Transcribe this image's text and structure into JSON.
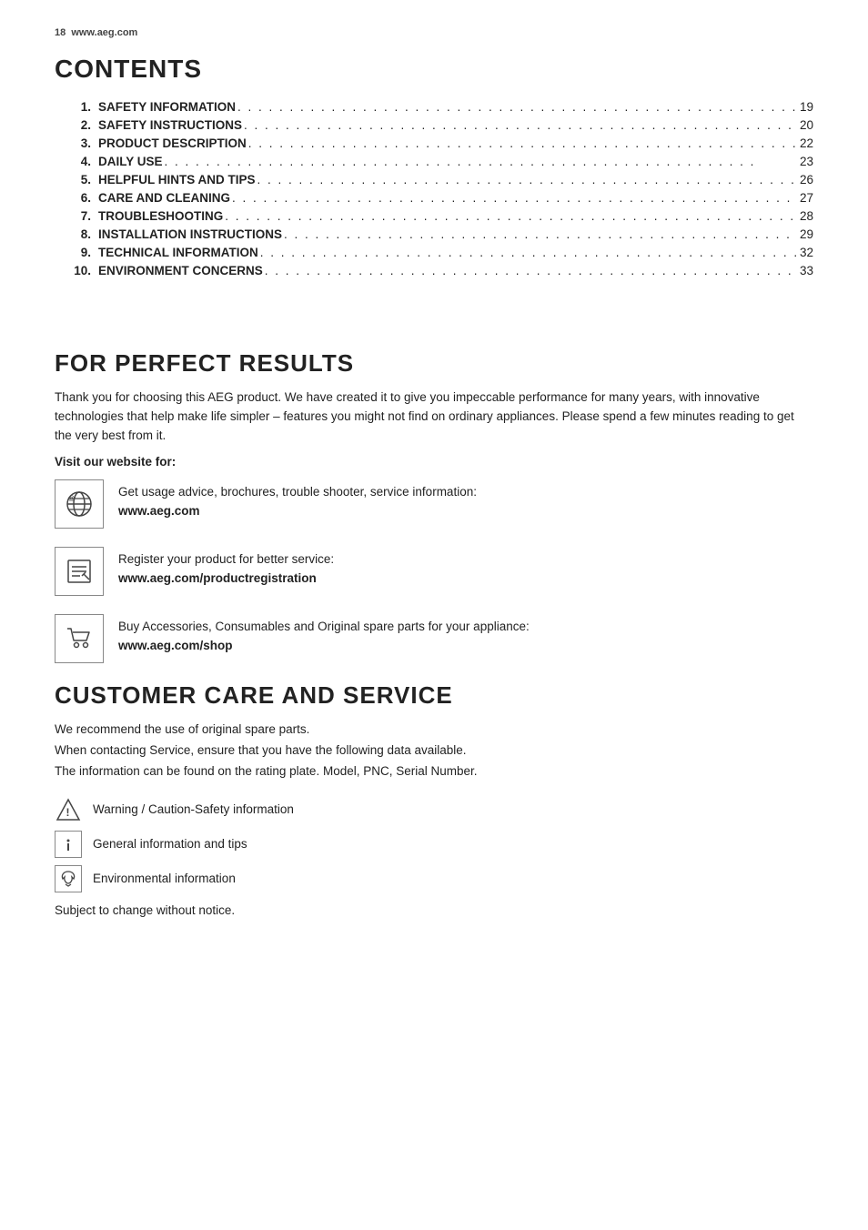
{
  "header": {
    "page_num": "18",
    "website": "www.aeg.com"
  },
  "contents": {
    "title": "CONTENTS",
    "items": [
      {
        "num": "1.",
        "label": "SAFETY INFORMATION",
        "page": "19"
      },
      {
        "num": "2.",
        "label": "SAFETY INSTRUCTIONS",
        "page": "20"
      },
      {
        "num": "3.",
        "label": "PRODUCT DESCRIPTION",
        "page": "22"
      },
      {
        "num": "4.",
        "label": "DAILY USE",
        "page": "23"
      },
      {
        "num": "5.",
        "label": "HELPFUL HINTS AND TIPS",
        "page": "26"
      },
      {
        "num": "6.",
        "label": "CARE AND CLEANING",
        "page": "27"
      },
      {
        "num": "7.",
        "label": "TROUBLESHOOTING",
        "page": "28"
      },
      {
        "num": "8.",
        "label": "INSTALLATION INSTRUCTIONS",
        "page": "29"
      },
      {
        "num": "9.",
        "label": "TECHNICAL INFORMATION",
        "page": "32"
      },
      {
        "num": "10.",
        "label": "ENVIRONMENT CONCERNS",
        "page": "33"
      }
    ]
  },
  "for_perfect": {
    "title": "FOR PERFECT RESULTS",
    "body": "Thank you for choosing this AEG product. We have created it to give you impeccable performance for many years, with innovative technologies that help make life simpler – features you might not find on ordinary appliances. Please spend a few minutes reading to get the very best from it.",
    "visit_label": "Visit our website for:",
    "icons": [
      {
        "icon": "globe",
        "text_plain": "Get usage advice, brochures, trouble shooter, service information:",
        "text_bold": "www.aeg.com"
      },
      {
        "icon": "register",
        "text_plain": "Register your product for better service:",
        "text_bold": "www.aeg.com/productregistration"
      },
      {
        "icon": "cart",
        "text_plain": "Buy Accessories, Consumables and Original spare parts for your appliance:",
        "text_bold": "www.aeg.com/shop"
      }
    ]
  },
  "customer_care": {
    "title": "CUSTOMER CARE AND SERVICE",
    "lines": [
      "We recommend the use of original spare parts.",
      "When contacting Service, ensure that you have the following data available.",
      "The information can be found on the rating plate. Model, PNC, Serial Number."
    ],
    "legend": [
      {
        "icon_type": "triangle",
        "symbol": "⚠",
        "label": "Warning / Caution-Safety information"
      },
      {
        "icon_type": "box",
        "symbol": "i",
        "label": "General information and tips"
      },
      {
        "icon_type": "box",
        "symbol": "♻",
        "label": "Environmental information"
      }
    ],
    "subject_to_change": "Subject to change without notice."
  }
}
